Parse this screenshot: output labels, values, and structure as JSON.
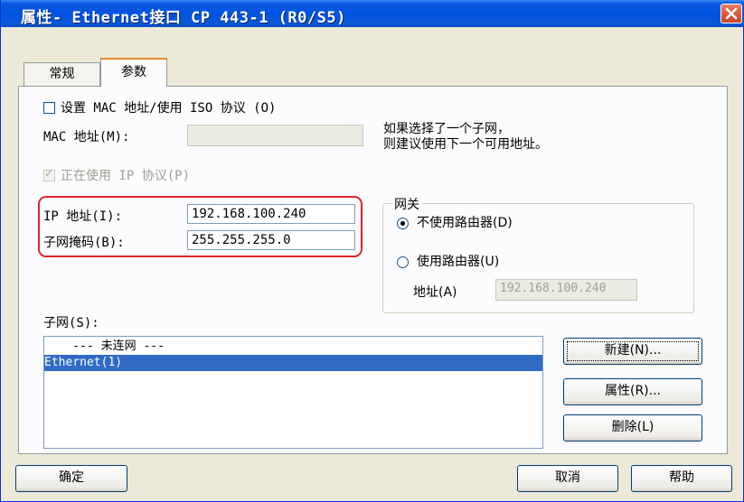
{
  "window": {
    "title": "属性- Ethernet接口  CP 443-1 (R0/S5)"
  },
  "tabs": [
    {
      "label": "常规"
    },
    {
      "label": "参数"
    }
  ],
  "mac": {
    "checkbox_label": "设置 MAC 地址/使用 ISO 协议 (O)",
    "address_label": "MAC 地址(M):",
    "address_value": "",
    "hint_line1": "如果选择了一个子网，",
    "hint_line2": "则建议使用下一个可用地址。"
  },
  "ip": {
    "protocol_label": "正在使用 IP 协议(P)",
    "address_label": "IP 地址(I):",
    "address_value": "192.168.100.240",
    "subnet_label": "子网掩码(B):",
    "subnet_value": "255.255.255.0"
  },
  "gateway": {
    "group_title": "网关",
    "no_router_label": "不使用路由器(D)",
    "use_router_label": "使用路由器(U)",
    "address_label": "地址(A)",
    "address_value": "192.168.100.240"
  },
  "subnet": {
    "label": "子网(S):",
    "items": [
      "    --- 未连网 ---",
      "Ethernet(1)"
    ],
    "selected_index": 1
  },
  "side_buttons": {
    "new": "新建(N)...",
    "properties": "属性(R)...",
    "delete": "删除(L)"
  },
  "footer": {
    "ok": "确定",
    "cancel": "取消",
    "help": "帮助"
  },
  "colors": {
    "titlebar": "#0053e1",
    "selection": "#316ac5",
    "highlight_annotation": "#e0242c"
  }
}
